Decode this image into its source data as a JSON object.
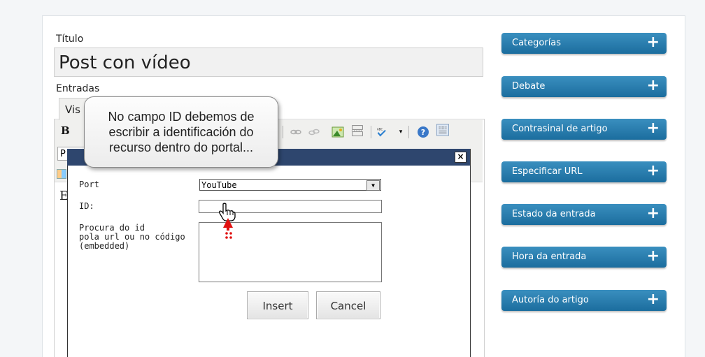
{
  "post": {
    "title_label": "Título",
    "title_value": "Post con vídeo",
    "entries_label": "Entradas",
    "tab_visual": "Vis",
    "bold": "B",
    "paragraph_select": "P",
    "content_first_letter": "E"
  },
  "callout": {
    "line1": "No campo ID debemos de",
    "line2": "escribir a identificación do",
    "line3": "recurso dentro do portal..."
  },
  "dialog": {
    "close_label": "×",
    "portal_label": "Port",
    "portal_value": "YouTube",
    "id_label": "ID:",
    "search_label_line1": "Procura do id",
    "search_label_line2": "pola url ou no código",
    "search_label_line3": "(embedded)",
    "insert_label": "Insert",
    "cancel_label": "Cancel"
  },
  "sidebar": {
    "items": [
      {
        "label": "Categorías"
      },
      {
        "label": "Debate"
      },
      {
        "label": "Contrasinal de artigo"
      },
      {
        "label": "Especificar URL"
      },
      {
        "label": "Estado da entrada"
      },
      {
        "label": "Hora da entrada"
      },
      {
        "label": "Autoría do artigo"
      }
    ],
    "plus_symbol": "+"
  },
  "colors": {
    "sidebar_accent": "#1f73a3",
    "dialog_titlebar": "#2e466e",
    "cursor_arrow": "#e01010"
  }
}
